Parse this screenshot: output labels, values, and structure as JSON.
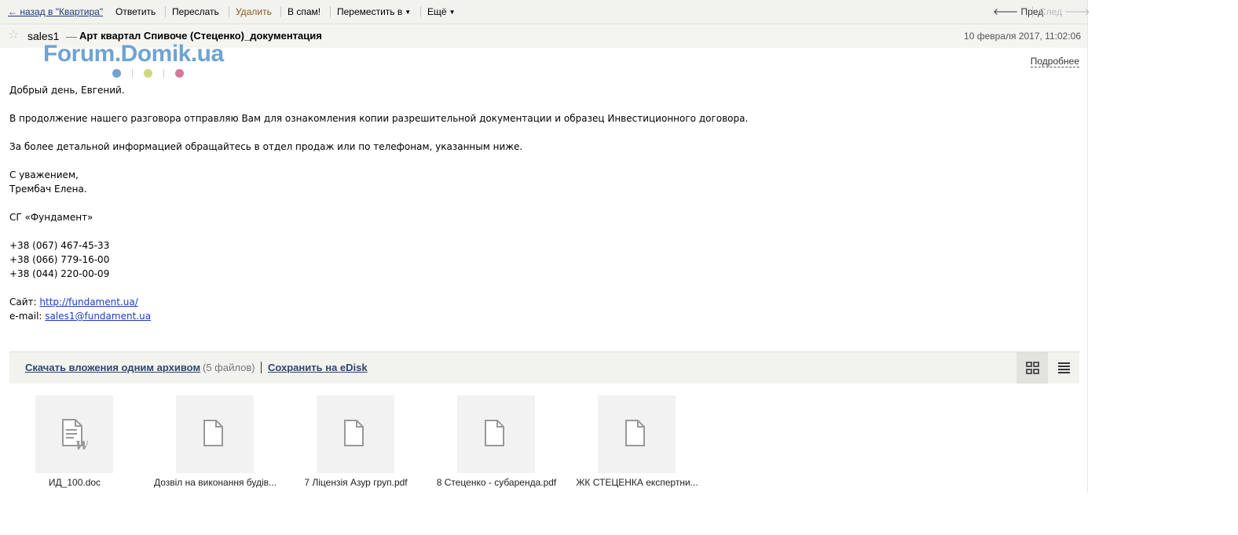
{
  "toolbar": {
    "back": "← назад в \"Квартира\"",
    "reply": "Ответить",
    "forward": "Переслать",
    "delete": "Удалить",
    "spam": "В спам!",
    "move": "Переместить в",
    "more": "Ещё",
    "prev": "Пред",
    "next": "След"
  },
  "message": {
    "from": "sales1",
    "dash": "—",
    "subject": "Арт квартал Спивоче (Стеценко)_документация",
    "date": "10 февраля 2017, 11:02:06",
    "details": "Подробнее",
    "logo": "Forum.Domik.ua",
    "body": {
      "greeting": "Добрый день, Евгений.",
      "p1": "В продолжение нашего разговора отправляю Вам для ознакомления копии разрешительной документации и образец Инвестиционного договора.",
      "p2": "За более детальной информацией обращайтесь в отдел продаж или по телефонам, указанным ниже.",
      "regards": "С уважением,",
      "name": "Трембач Елена.",
      "company": "СГ «Фундамент»",
      "phones": [
        "+38 (067) 467-45-33",
        "+38 (066) 779-16-00",
        "+38 (044) 220-00-09"
      ],
      "site_label": "Сайт: ",
      "site_url": "http://fundament.ua/",
      "email_label": "e-mail: ",
      "email": "sales1@fundament.ua"
    }
  },
  "attachments": {
    "download_all": "Скачать вложения одним архивом",
    "count": "(5 файлов)",
    "save_edisk": "Сохранить на eDisk",
    "files": [
      {
        "name": "ИД_100.doc",
        "icon": "word-doc-icon"
      },
      {
        "name": "Дозвіл на виконання будів...",
        "icon": "file-icon"
      },
      {
        "name": "7 Ліцензія Азур груп.pdf",
        "icon": "file-icon"
      },
      {
        "name": "8 Стеценко - субаренда.pdf",
        "icon": "file-icon"
      },
      {
        "name": "ЖК СТЕЦЕНКА експертни...",
        "icon": "file-icon"
      }
    ]
  },
  "colors": {
    "toolbar_bg": "#f2f2ef",
    "link": "#1a3ec2",
    "delete": "#8a5a1c",
    "logo_blue": "#6fa3d2"
  }
}
